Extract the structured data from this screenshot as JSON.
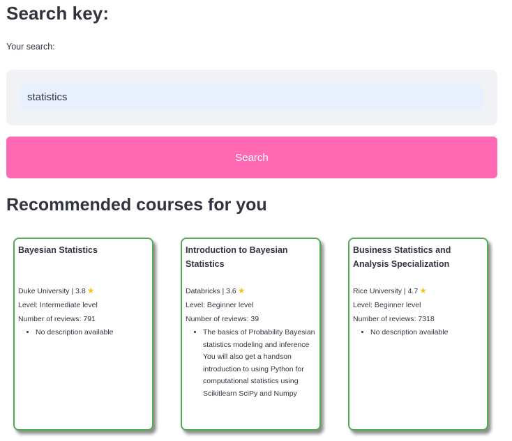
{
  "search_section": {
    "heading": "Search key:",
    "label": "Your search:",
    "input_value": "statistics",
    "button_label": "Search",
    "button_color": "#ff69b4"
  },
  "recommendations": {
    "heading": "Recommended courses for you",
    "card_border_color": "#4caf50",
    "courses": [
      {
        "title": "Bayesian Statistics",
        "provider_rating": "Duke University | 3.8",
        "level": "Level: Intermediate level",
        "reviews": "Number of reviews: 791",
        "description": "No description available",
        "rating_icon": "star-icon"
      },
      {
        "title": "Introduction to Bayesian Statistics",
        "provider_rating": "Databricks | 3.6",
        "level": "Level: Beginner level",
        "reviews": "Number of reviews: 39",
        "description": "The basics of Probability Bayesian statistics modeling and inference You will also get a handson introduction to using Python for computational statistics using Scikitlearn SciPy and Numpy",
        "rating_icon": "star-icon"
      },
      {
        "title": "Business Statistics and Analysis Specialization",
        "provider_rating": "Rice University | 4.7",
        "level": "Level: Beginner level",
        "reviews": "Number of reviews: 7318",
        "description": "No description available",
        "rating_icon": "star-icon"
      }
    ]
  }
}
